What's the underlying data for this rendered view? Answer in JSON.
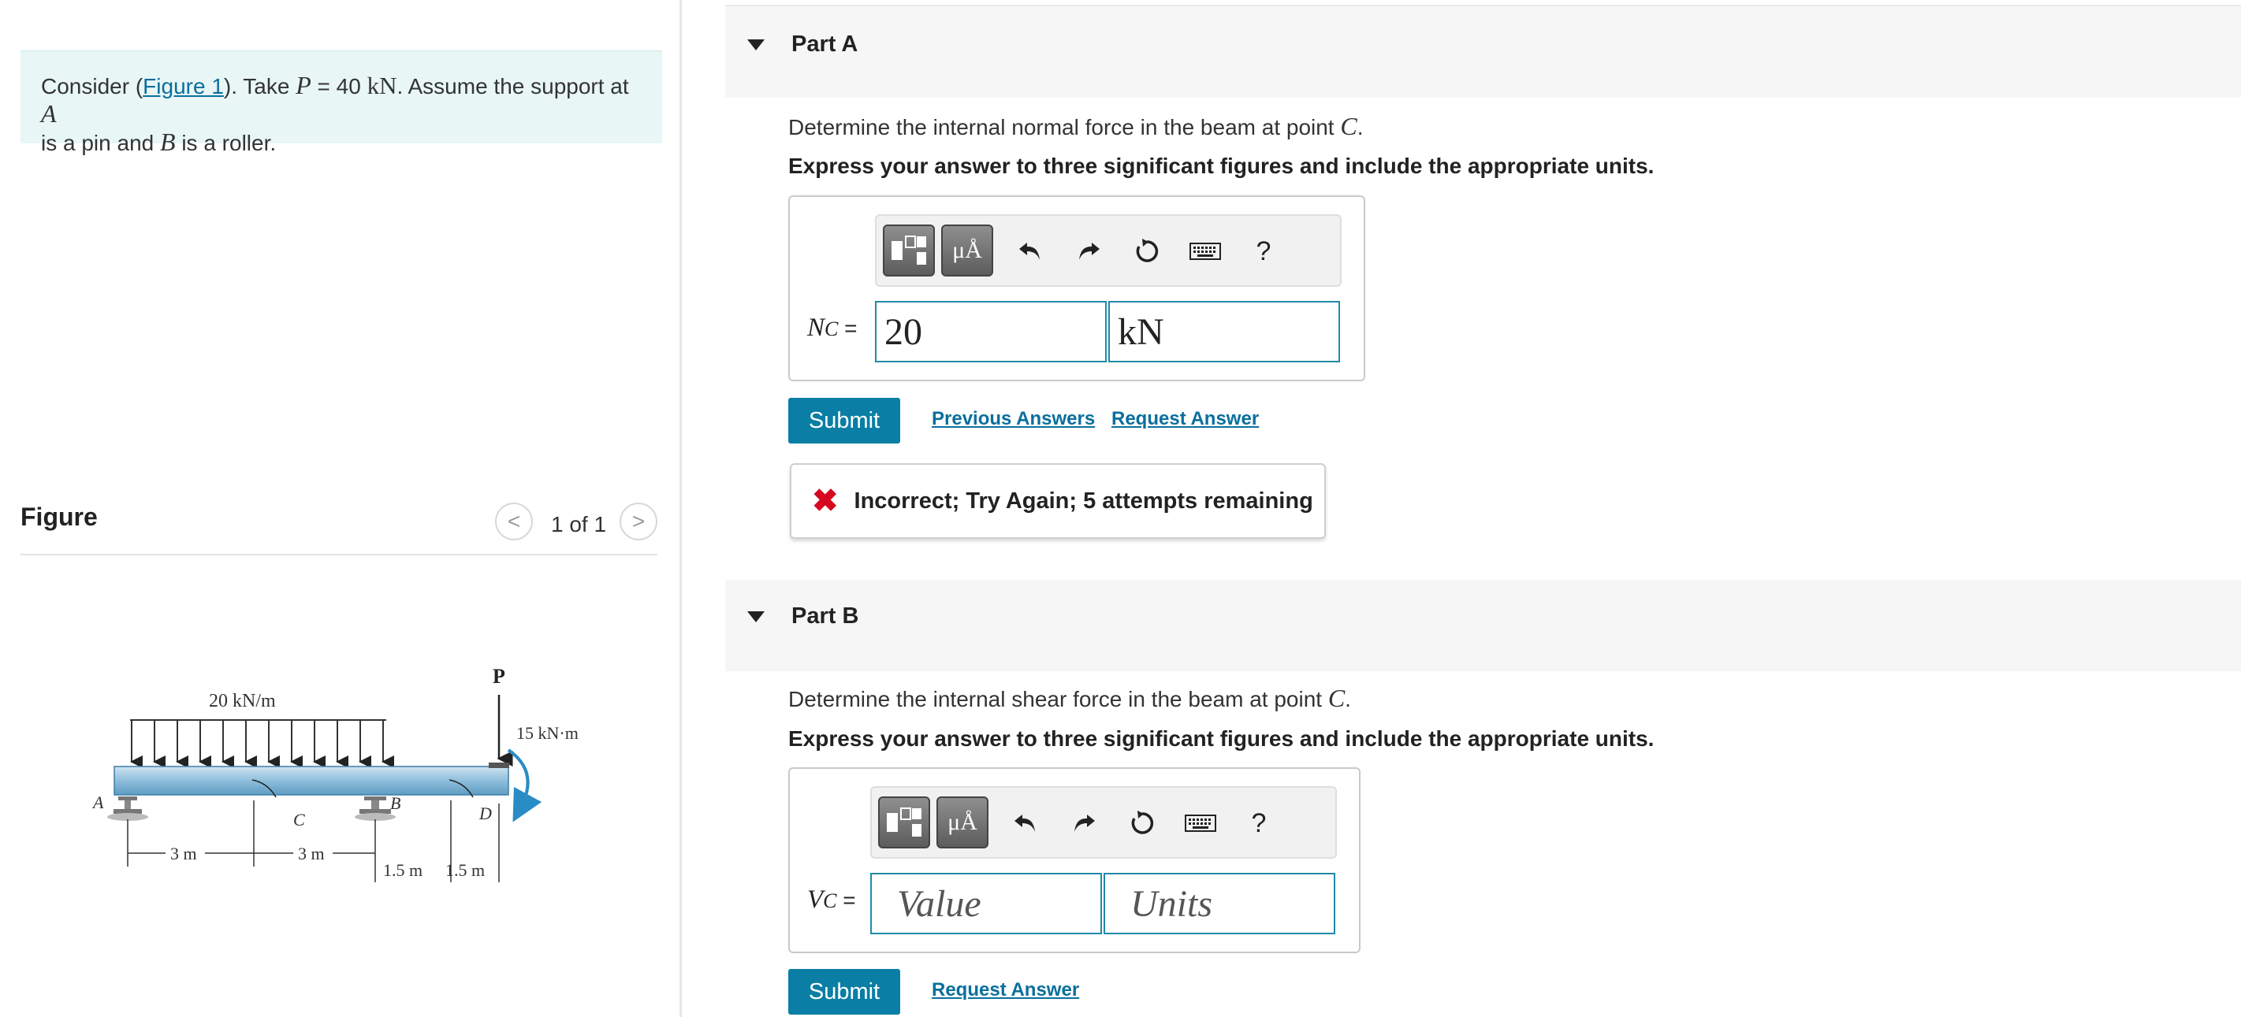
{
  "problem": {
    "text_prefix": "Consider (",
    "figure_link": "Figure 1",
    "text_mid": "). Take ",
    "P_var": "P",
    "P_value": " = 40 ",
    "P_unit": "kN",
    "text_mid2": ". Assume the support at ",
    "A_var": "A",
    "line2_prefix": "is a pin and ",
    "B_var": "B",
    "line2_suffix": " is a roller."
  },
  "figure_panel": {
    "title": "Figure",
    "count": "1 of 1",
    "prev": "<",
    "next": ">"
  },
  "figure": {
    "dist_load": "20 kN/m",
    "force": "P",
    "moment": "15 kN·m",
    "A": "A",
    "B": "B",
    "C": "C",
    "D": "D",
    "dim1": "3 m",
    "dim2": "3 m",
    "dim3": "1.5 m",
    "dim4": "1.5 m"
  },
  "part_a": {
    "label": "Part A",
    "question_prefix": "Determine the internal normal force in the beam at point ",
    "question_var": "C",
    "question_suffix": ".",
    "instruction": "Express your answer to three significant figures and include the appropriate units.",
    "eq_var": "N",
    "eq_sub": "C",
    "eq_sign": " =",
    "value": "20",
    "units": "kN",
    "submit": "Submit",
    "previous_answers": "Previous Answers",
    "request_answer": "Request Answer",
    "feedback_icon": "✖",
    "feedback": "Incorrect; Try Again; 5 attempts remaining"
  },
  "part_b": {
    "label": "Part B",
    "question_prefix": "Determine the internal shear force in the beam at point ",
    "question_var": "C",
    "question_suffix": ".",
    "instruction": "Express your answer to three significant figures and include the appropriate units.",
    "eq_var": "V",
    "eq_sub": "C",
    "eq_sign": " =",
    "value_placeholder": "Value",
    "units_placeholder": "Units",
    "submit": "Submit",
    "request_answer": "Request Answer"
  },
  "toolbar": {
    "units_btn": "μÅ",
    "help": "?"
  },
  "colors": {
    "accent": "#0a7ea4",
    "link": "#0a6f9d",
    "problem_bg": "#e8f6f6",
    "error": "#d4081f",
    "input_border": "#1f8aa6"
  }
}
